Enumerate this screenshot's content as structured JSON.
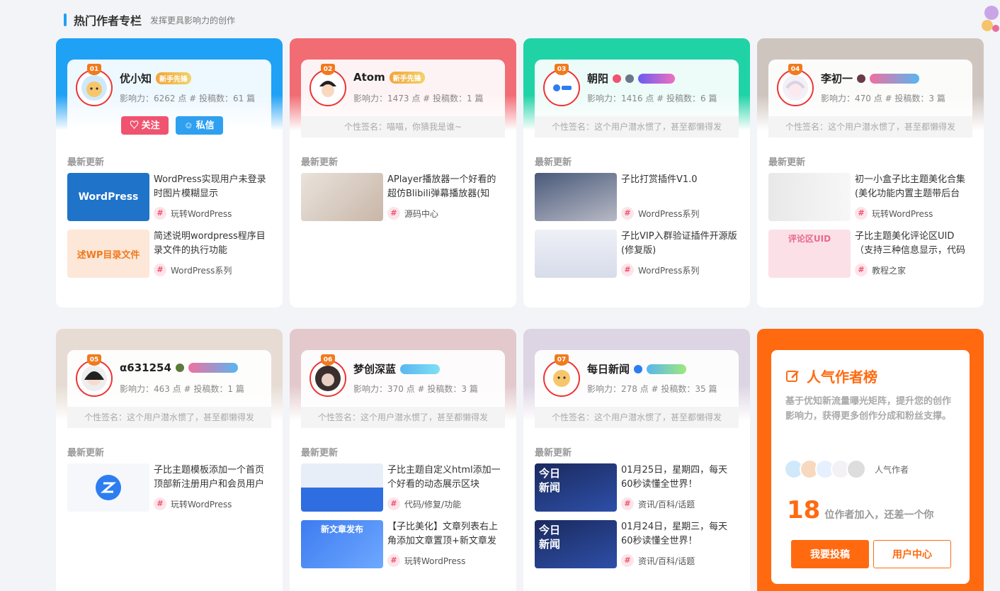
{
  "section": {
    "title": "热门作者专栏",
    "subtitle": "发挥更具影响力的创作"
  },
  "latest_label": "最新更新",
  "colors": {
    "accent": "#1fa1f5",
    "follow": "#f0536f",
    "message": "#2fa0f0",
    "ranking": "#ff6a10"
  },
  "authors": [
    {
      "rank": "01",
      "name": "优小知",
      "badge": "新手先锋",
      "stats": "影响力：6262 点 # 投稿数：61 篇",
      "follow_label": "关注",
      "message_label": "私信",
      "posts": [
        {
          "title": "WordPress实现用户未登录时图片模糊显示",
          "category": "玩转WordPress",
          "thumb_text": "WordPress"
        },
        {
          "title": "简述说明wordpress程序目录文件的执行功能",
          "category": "WordPress系列",
          "thumb_text": "述WP目录文件"
        }
      ]
    },
    {
      "rank": "02",
      "name": "Atom",
      "badge": "新手先锋",
      "stats": "影响力：1473 点 # 投稿数：1 篇",
      "signature": "个性签名：喵喵，你猜我是谁~",
      "posts": [
        {
          "title": "APlayer播放器一个好看的超仿Blibili弹幕播放器(知",
          "category": "源码中心"
        }
      ]
    },
    {
      "rank": "03",
      "name": "朝阳",
      "stats": "影响力：1416 点 # 投稿数：6 篇",
      "signature": "个性签名：这个用户潜水惯了，甚至都懒得发",
      "posts": [
        {
          "title": "子比打赏插件V1.0",
          "category": "WordPress系列"
        },
        {
          "title": "子比VIP入群验证插件开源版(修复版)",
          "category": "WordPress系列"
        }
      ]
    },
    {
      "rank": "04",
      "name": "李初一",
      "stats": "影响力：470 点 # 投稿数：3 篇",
      "signature": "个性签名：这个用户潜水惯了，甚至都懒得发",
      "posts": [
        {
          "title": "初一小盒子比主题美化合集(美化功能内置主题带后台",
          "category": "玩转WordPress"
        },
        {
          "title": "子比主题美化评论区UID（支持三种信息显示，代码",
          "category": "教程之家",
          "thumb_text": "评论区UID"
        }
      ]
    },
    {
      "rank": "05",
      "name": "α631254",
      "stats": "影响力：463 点 # 投稿数：1 篇",
      "signature": "个性签名：这个用户潜水惯了，甚至都懒得发",
      "posts": [
        {
          "title": "子比主题模板添加一个首页顶部新注册用户和会员用户",
          "category": "玩转WordPress"
        }
      ]
    },
    {
      "rank": "06",
      "name": "梦创深蓝",
      "stats": "影响力：370 点 # 投稿数：3 篇",
      "signature": "个性签名：这个用户潜水惯了，甚至都懒得发",
      "posts": [
        {
          "title": "子比主题自定义html添加一个好看的动态展示区块",
          "category": "代码/修复/功能"
        },
        {
          "title": "【子比美化】文章列表右上角添加文章置顶+新文章发",
          "category": "玩转WordPress",
          "thumb_text": "新文章发布"
        }
      ]
    },
    {
      "rank": "07",
      "name": "每日新闻",
      "stats": "影响力：278 点 # 投稿数：35 篇",
      "signature": "个性签名：这个用户潜水惯了，甚至都懒得发",
      "posts": [
        {
          "title": "01月25日，星期四，每天60秒读懂全世界！",
          "category": "资讯/百科/话题",
          "thumb_text": "今日新闻"
        },
        {
          "title": "01月24日，星期三，每天60秒读懂全世界！",
          "category": "资讯/百科/话题",
          "thumb_text": "今日新闻"
        }
      ]
    }
  ],
  "ranking": {
    "title": "人气作者榜",
    "desc": "基于优知新流量曝光矩阵，提升您的创作影响力，获得更多创作分成和粉丝支撑。",
    "avatars_label": "人气作者",
    "count": "18",
    "count_text": "位作者加入，还差一个你",
    "submit_label": "我要投稿",
    "center_label": "用户中心"
  }
}
